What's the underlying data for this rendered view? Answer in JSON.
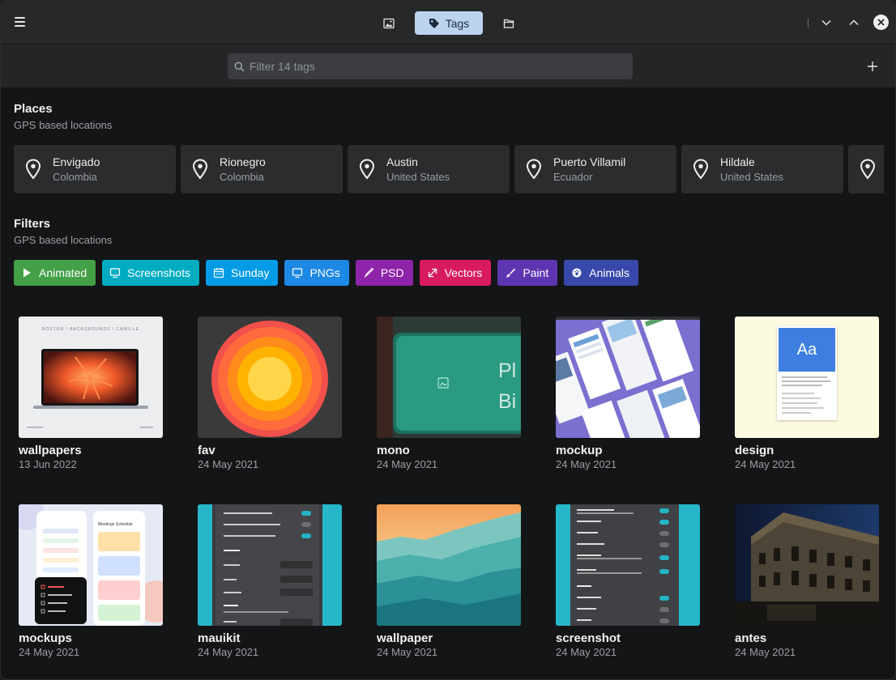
{
  "header": {
    "tags_label": "Tags"
  },
  "search": {
    "placeholder": "Filter 14 tags"
  },
  "places": {
    "title": "Places",
    "subtitle": "GPS based locations",
    "items": [
      {
        "city": "Envigado",
        "country": "Colombia"
      },
      {
        "city": "Rionegro",
        "country": "Colombia"
      },
      {
        "city": "Austin",
        "country": "United States"
      },
      {
        "city": "Puerto Villamil",
        "country": "Ecuador"
      },
      {
        "city": "Hildale",
        "country": "United States"
      },
      {
        "city": "",
        "country": ""
      }
    ]
  },
  "filters": {
    "title": "Filters",
    "subtitle": "GPS based locations",
    "items": [
      {
        "label": "Animated",
        "icon": "play-icon",
        "color": "#43a047"
      },
      {
        "label": "Screenshots",
        "icon": "monitor-icon",
        "color": "#00acc1"
      },
      {
        "label": "Sunday",
        "icon": "calendar-icon",
        "color": "#039be5"
      },
      {
        "label": "PNGs",
        "icon": "monitor-icon",
        "color": "#1e88e5"
      },
      {
        "label": "PSD",
        "icon": "brush-icon",
        "color": "#8e24aa"
      },
      {
        "label": "Vectors",
        "icon": "resize-arrow-icon",
        "color": "#d81b60"
      },
      {
        "label": "Paint",
        "icon": "paintbrush-icon",
        "color": "#5e35b1"
      },
      {
        "label": "Animals",
        "icon": "paw-icon",
        "color": "#3949ab"
      }
    ]
  },
  "tags": [
    {
      "name": "wallpapers",
      "date": "13 Jun 2022"
    },
    {
      "name": "fav",
      "date": "24 May 2021"
    },
    {
      "name": "mono",
      "date": "24 May 2021"
    },
    {
      "name": "mockup",
      "date": "24 May 2021"
    },
    {
      "name": "design",
      "date": "24 May 2021"
    },
    {
      "name": "mockups",
      "date": "24 May 2021"
    },
    {
      "name": "mauikit",
      "date": "24 May 2021"
    },
    {
      "name": "wallpaper",
      "date": "24 May 2021"
    },
    {
      "name": "screenshot",
      "date": "24 May 2021"
    },
    {
      "name": "antes",
      "date": "24 May 2021"
    }
  ],
  "thumb_text": {
    "wallpapers_brand": "BOSTON / BACKGROUNDS / CAMILLE",
    "mono_text": "Pl Bi",
    "design_glyph": "Aa",
    "mockups_title": "Meetings Schedule"
  }
}
